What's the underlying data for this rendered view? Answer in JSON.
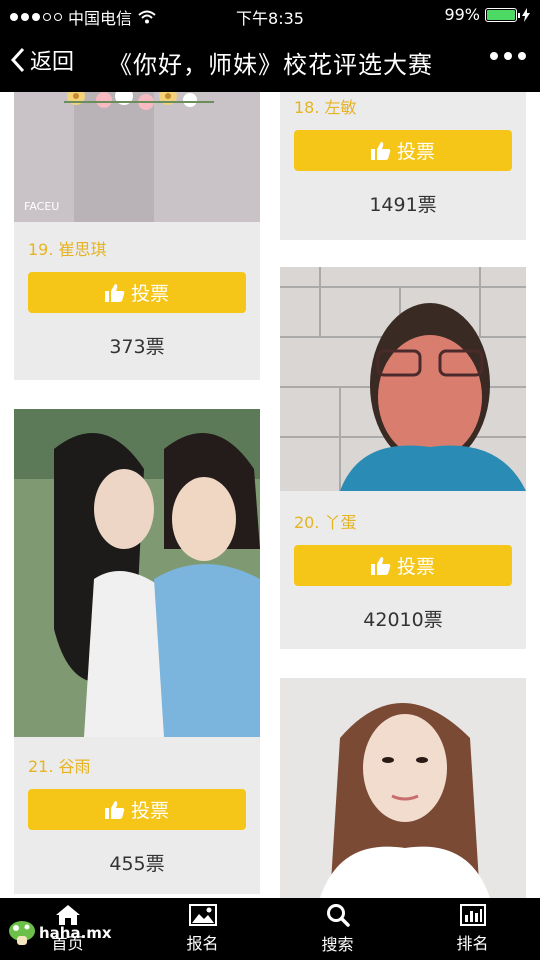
{
  "status": {
    "carrier": "中国电信",
    "time": "下午8:35",
    "battery": "99%",
    "battery_level": 0.99
  },
  "nav": {
    "back_label": "返回",
    "title": "《你好，师妹》校花评选大赛"
  },
  "vote_label": "投票",
  "cards": [
    {
      "name": "18. 左敏",
      "votes": "1491票"
    },
    {
      "name": "19. 崔思琪",
      "votes": "373票"
    },
    {
      "name": "20. 丫蛋",
      "votes": "42010票"
    },
    {
      "name": "21. 谷雨",
      "votes": "455票"
    }
  ],
  "photo_text": "FACEU",
  "tabs": [
    {
      "label": "首页",
      "icon": "home-icon"
    },
    {
      "label": "报名",
      "icon": "image-icon"
    },
    {
      "label": "搜索",
      "icon": "search-icon"
    },
    {
      "label": "排名",
      "icon": "bar-chart-icon"
    }
  ],
  "watermark": "haha.mx"
}
